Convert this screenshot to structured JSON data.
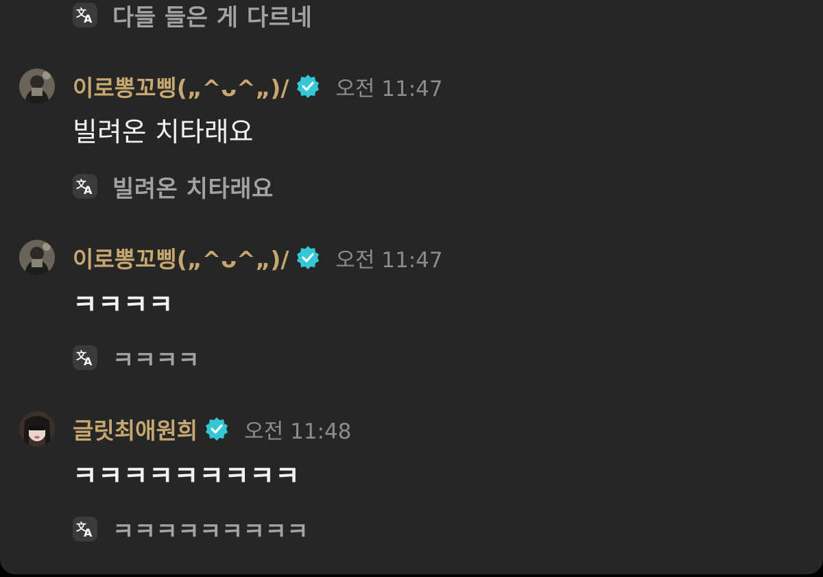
{
  "colors": {
    "background": "#262627",
    "username": "#c7a770",
    "verified_badge": "#35c7d6",
    "timestamp": "#8c8c8e",
    "message_text": "#f2f2f2",
    "translation_text": "#a2a2a4"
  },
  "icons": {
    "translate": "translate-icon",
    "verified": "verified-badge-icon"
  },
  "top_translation": {
    "text": "다들 들은 게 다르네"
  },
  "messages": [
    {
      "username": "이로뽕꼬삥(„^ᴗ^„)/",
      "timestamp": "오전 11:47",
      "text": "빌려온 치타래요",
      "translation": "빌려온 치타래요"
    },
    {
      "username": "이로뽕꼬삥(„^ᴗ^„)/",
      "timestamp": "오전 11:47",
      "text": "ㅋㅋㅋㅋ",
      "translation": "ㅋㅋㅋㅋ"
    },
    {
      "username": "글릿최애원희",
      "timestamp": "오전 11:48",
      "text": "ㅋㅋㅋㅋㅋㅋㅋㅋㅋ",
      "translation": "ㅋㅋㅋㅋㅋㅋㅋㅋㅋ"
    }
  ]
}
